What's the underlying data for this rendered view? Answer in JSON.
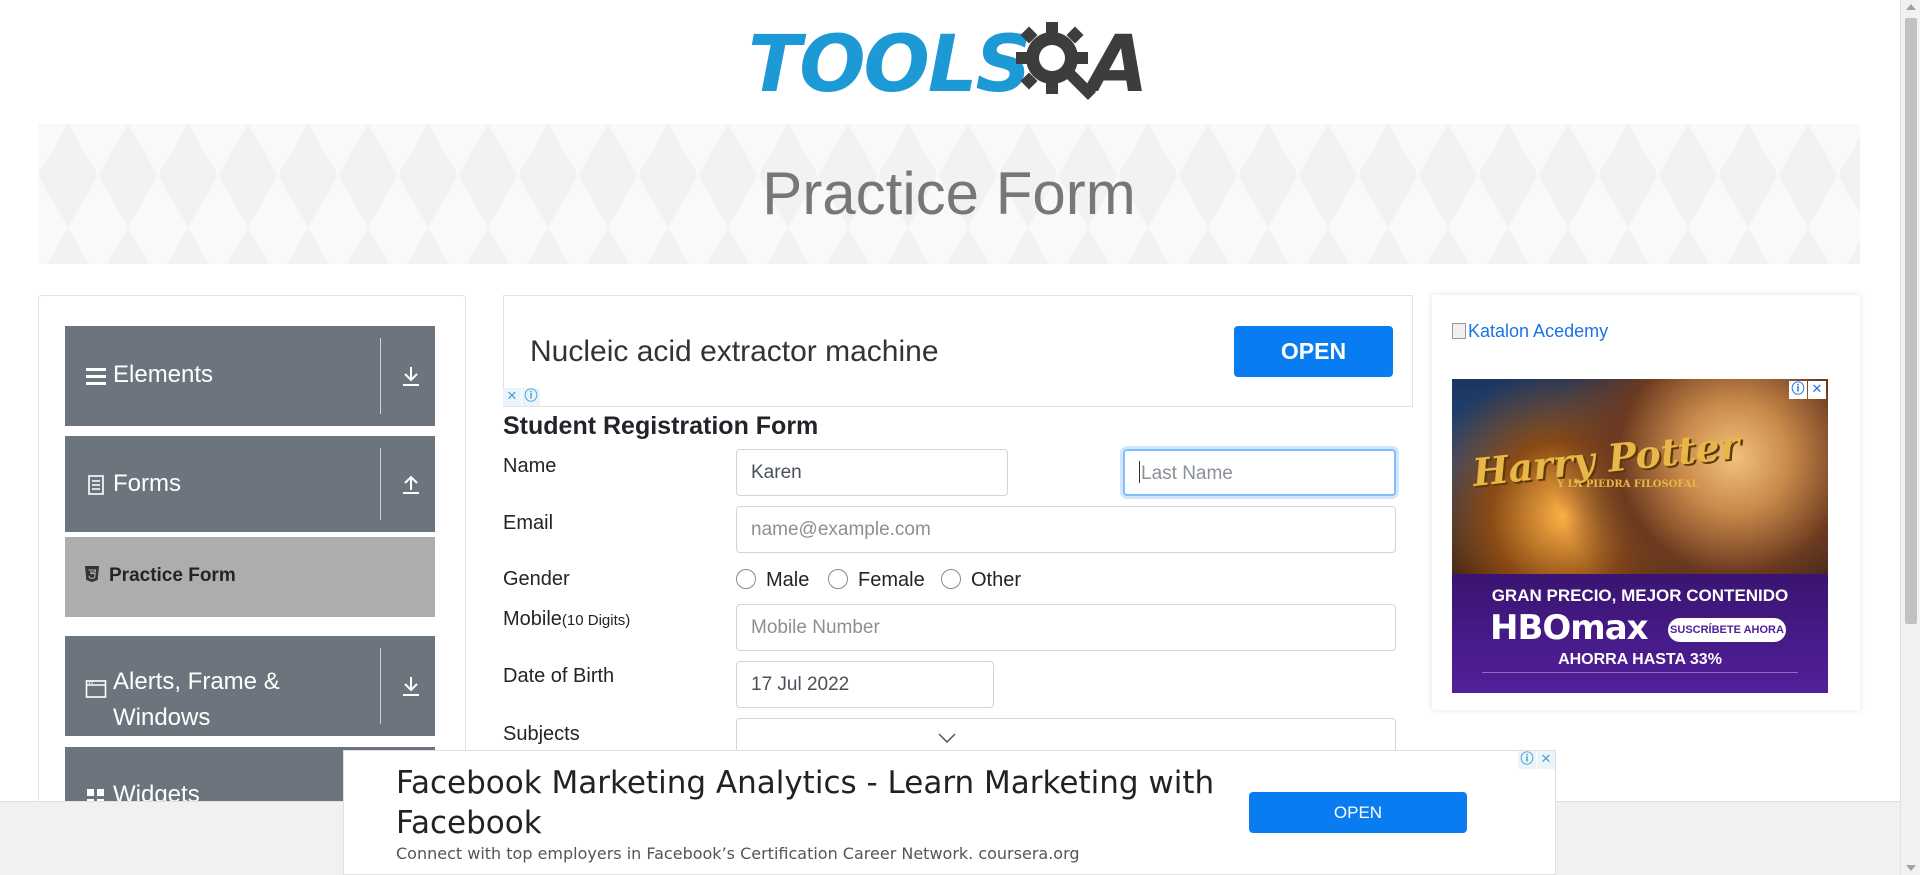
{
  "logo": {
    "text": "TOOLS",
    "suffix": "A"
  },
  "banner": {
    "title": "Practice Form"
  },
  "sidebar": {
    "groups": [
      {
        "label": "Elements",
        "icon": "menu-icon",
        "arrow": "download-arrow-icon"
      },
      {
        "label": "Forms",
        "icon": "document-icon",
        "arrow": "upload-arrow-icon"
      },
      {
        "label": "Alerts, Frame & Windows",
        "icon": "window-icon",
        "arrow": "download-arrow-icon"
      },
      {
        "label": "Widgets",
        "icon": "widgets-icon"
      }
    ],
    "active_item": {
      "label": "Practice Form",
      "icon": "html5-icon"
    }
  },
  "ad_top": {
    "title": "Nucleic acid extractor machine",
    "button": "OPEN"
  },
  "form": {
    "title": "Student Registration Form",
    "name_label": "Name",
    "first_name_value": "Karen",
    "last_name_placeholder": "Last Name",
    "email_label": "Email",
    "email_placeholder": "name@example.com",
    "gender_label": "Gender",
    "gender_options": [
      "Male",
      "Female",
      "Other"
    ],
    "mobile_label": "Mobile",
    "mobile_hint": "(10 Digits)",
    "mobile_placeholder": "Mobile Number",
    "dob_label": "Date of Birth",
    "dob_value": "17 Jul 2022",
    "subjects_label": "Subjects"
  },
  "ad_right": {
    "link_text": "Katalon Acedemy",
    "poster_title": "Harry Potter",
    "poster_subtitle": "Y LA PIEDRA FILOSOFAL",
    "headline": "GRAN PRECIO, MEJOR CONTENIDO",
    "brand": "HBOmax",
    "cta": "SUSCRÍBETE AHORA",
    "promo": "AHORRA HASTA 33%"
  },
  "ad_bottom": {
    "title": "Facebook Marketing Analytics - Learn Marketing with Facebook",
    "subtitle": "Connect with top employers in Facebook’s Certification Career Network. coursera.org",
    "button": "OPEN"
  },
  "colors": {
    "brand_blue": "#1d9ad6",
    "sidebar_gray": "#6c757d",
    "active_gray": "#adadad",
    "button_blue": "#0a7cf2",
    "focus_blue": "#80bdff"
  }
}
